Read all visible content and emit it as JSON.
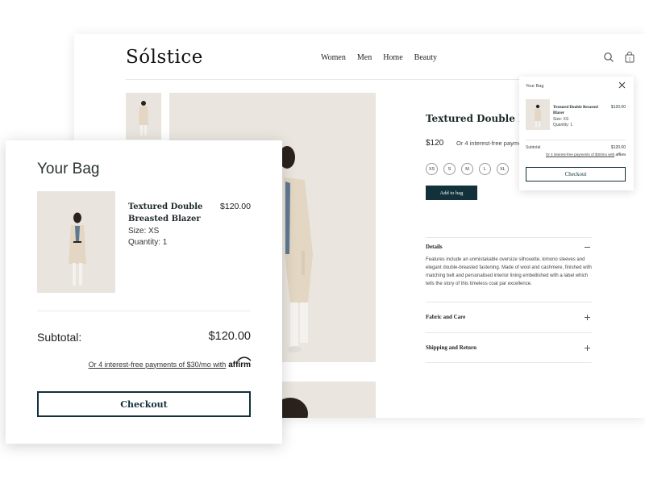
{
  "store": {
    "logo": "Sólstice",
    "nav": [
      "Women",
      "Men",
      "Home",
      "Beauty"
    ]
  },
  "product": {
    "title": "Textured Double Breasted Blazer",
    "title_visible": "Textured Double Brea",
    "price": "$120",
    "installment": "Or 4 interest-free payments of $30/mo with affirm",
    "installment_visible": "Or 4 interest-free payme",
    "sizes": [
      "XS",
      "S",
      "M",
      "L",
      "XL"
    ],
    "add_to_bag": "Add to bag",
    "details_title": "Details",
    "details_text": "Features include an unmistakable oversize silhouette, kimono sleeves and elegant double-breasted fastening. Made of wool and cashmere, finished with matching belt and personalised interior lining embellished with a label which tells the story of this timeless coat par excellence.",
    "fabric_title": "Fabric and Care",
    "shipping_title": "Shipping and Return"
  },
  "mini_bag": {
    "title": "Your Bag",
    "item_name": "Textured Double Breasted Blazer",
    "item_price": "$120.00",
    "size": "Size: XS",
    "quantity": "Quantity: 1",
    "subtotal_label": "Subtotal",
    "subtotal_value": "$120.00",
    "affirm_link": "Or 4 interest-free payments of $30/mo with",
    "affirm_logo": "affirm",
    "checkout": "Checkout"
  },
  "bag": {
    "title": "Your Bag",
    "item_name": "Textured Double Breasted Blazer",
    "item_price": "$120.00",
    "size": "Size: XS",
    "quantity": "Quantity: 1",
    "subtotal_label": "Subtotal:",
    "subtotal_value": "$120.00",
    "affirm_link": "Or 4 interest-free payments of $30/mo with",
    "affirm_logo": "affirm",
    "checkout": "Checkout"
  },
  "colors": {
    "accent": "#12313a",
    "photo_bg": "#eae6df",
    "coat": "#e3d6c3"
  },
  "icons": [
    "search-icon",
    "bag-icon",
    "close-icon",
    "plus-icon",
    "minus-icon"
  ]
}
